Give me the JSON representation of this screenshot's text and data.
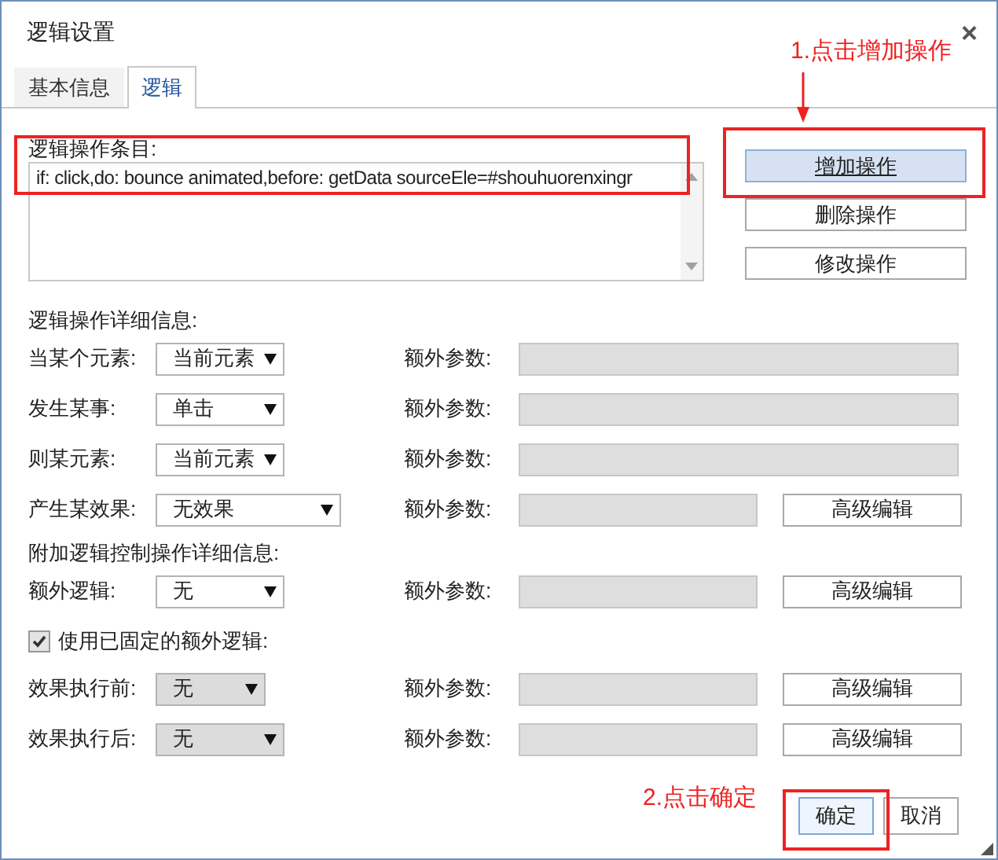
{
  "window": {
    "title": "逻辑设置",
    "close": "×"
  },
  "tabs": [
    {
      "label": "基本信息",
      "selected": false
    },
    {
      "label": "逻辑",
      "selected": true
    }
  ],
  "logic_list": {
    "label": "逻辑操作条目:",
    "items": [
      {
        "text": "if: click,do: bounce animated,before: getData sourceEle=#shouhuorenxingr",
        "selected": false
      }
    ]
  },
  "side_buttons": [
    "增加操作",
    "删除操作",
    "修改操作"
  ],
  "detail_section": {
    "title": "逻辑操作详细信息:",
    "rows": [
      {
        "label": "当某个元素:",
        "select": {
          "value": "当前元素",
          "disabled": false
        },
        "param_label": "额外参数:"
      },
      {
        "label": "发生某事:",
        "select": {
          "value": "单击",
          "disabled": false
        },
        "param_label": "额外参数:"
      },
      {
        "label": "则某元素:",
        "select": {
          "value": "当前元素",
          "disabled": false
        },
        "param_label": "额外参数:"
      },
      {
        "label": "产生某效果:",
        "select": {
          "value": "无效果",
          "disabled": false
        },
        "param_label": "额外参数:",
        "button": "高级编辑"
      }
    ]
  },
  "extra_section": {
    "title": "附加逻辑控制操作详细信息:",
    "rows": [
      {
        "label": "额外逻辑:",
        "select": {
          "value": "无",
          "disabled": false
        },
        "param_label": "额外参数:",
        "button": "高级编辑"
      }
    ]
  },
  "fixed_logic": {
    "label": "使用已固定的额外逻辑:",
    "checked": true,
    "rows": [
      {
        "label": "效果执行前:",
        "select": {
          "value": "无",
          "disabled": true
        },
        "param_label": "额外参数:",
        "button": "高级编辑"
      },
      {
        "label": "效果执行后:",
        "select": {
          "value": "无",
          "disabled": true
        },
        "param_label": "额外参数:",
        "button": "高级编辑"
      }
    ]
  },
  "footer_buttons": [
    {
      "label": "确定",
      "selected": true
    },
    {
      "label": "取消",
      "selected": false
    }
  ],
  "annotations": [
    "1.点击增加操作",
    "2.点击确定"
  ]
}
